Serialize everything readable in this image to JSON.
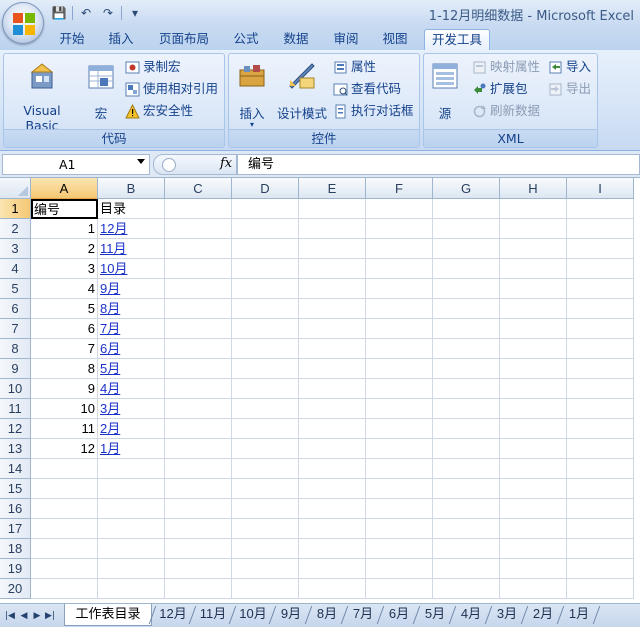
{
  "window": {
    "title": "1-12月明细数据 - Microsoft Excel"
  },
  "quick_access": {
    "icons": [
      "save-icon",
      "undo-icon",
      "redo-icon",
      "customize-icon"
    ]
  },
  "tabs": [
    "开始",
    "插入",
    "页面布局",
    "公式",
    "数据",
    "审阅",
    "视图",
    "开发工具"
  ],
  "active_tab": "开发工具",
  "ribbon": {
    "code": {
      "label": "代码",
      "visual_basic": "Visual Basic",
      "macros": "宏",
      "record_macro": "录制宏",
      "relative_refs": "使用相对引用",
      "macro_security": "宏安全性"
    },
    "controls": {
      "label": "控件",
      "insert": "插入",
      "design_mode": "设计模式",
      "properties": "属性",
      "view_code": "查看代码",
      "run_dialog": "执行对话框"
    },
    "xml": {
      "label": "XML",
      "source": "源",
      "map_properties": "映射属性",
      "expansion_packs": "扩展包",
      "refresh_data": "刷新数据",
      "import": "导入",
      "export": "导出"
    }
  },
  "formula_bar": {
    "name_box": "A1",
    "fx": "fx",
    "value": "编号"
  },
  "columns": [
    "A",
    "B",
    "C",
    "D",
    "E",
    "F",
    "G",
    "H",
    "I"
  ],
  "rows": [
    "1",
    "2",
    "3",
    "4",
    "5",
    "6",
    "7",
    "8",
    "9",
    "10",
    "11",
    "12",
    "13",
    "14",
    "15",
    "16",
    "17",
    "18",
    "19",
    "20"
  ],
  "cells": {
    "header": [
      "编号",
      "目录"
    ],
    "data": [
      [
        "1",
        "12月"
      ],
      [
        "2",
        "11月"
      ],
      [
        "3",
        "10月"
      ],
      [
        "4",
        "9月"
      ],
      [
        "5",
        "8月"
      ],
      [
        "6",
        "7月"
      ],
      [
        "7",
        "6月"
      ],
      [
        "8",
        "5月"
      ],
      [
        "9",
        "4月"
      ],
      [
        "10",
        "3月"
      ],
      [
        "11",
        "2月"
      ],
      [
        "12",
        "1月"
      ]
    ]
  },
  "sheet_tabs": [
    "工作表目录",
    "12月",
    "11月",
    "10月",
    "9月",
    "8月",
    "7月",
    "6月",
    "5月",
    "4月",
    "3月",
    "2月",
    "1月"
  ],
  "active_sheet": "工作表目录"
}
